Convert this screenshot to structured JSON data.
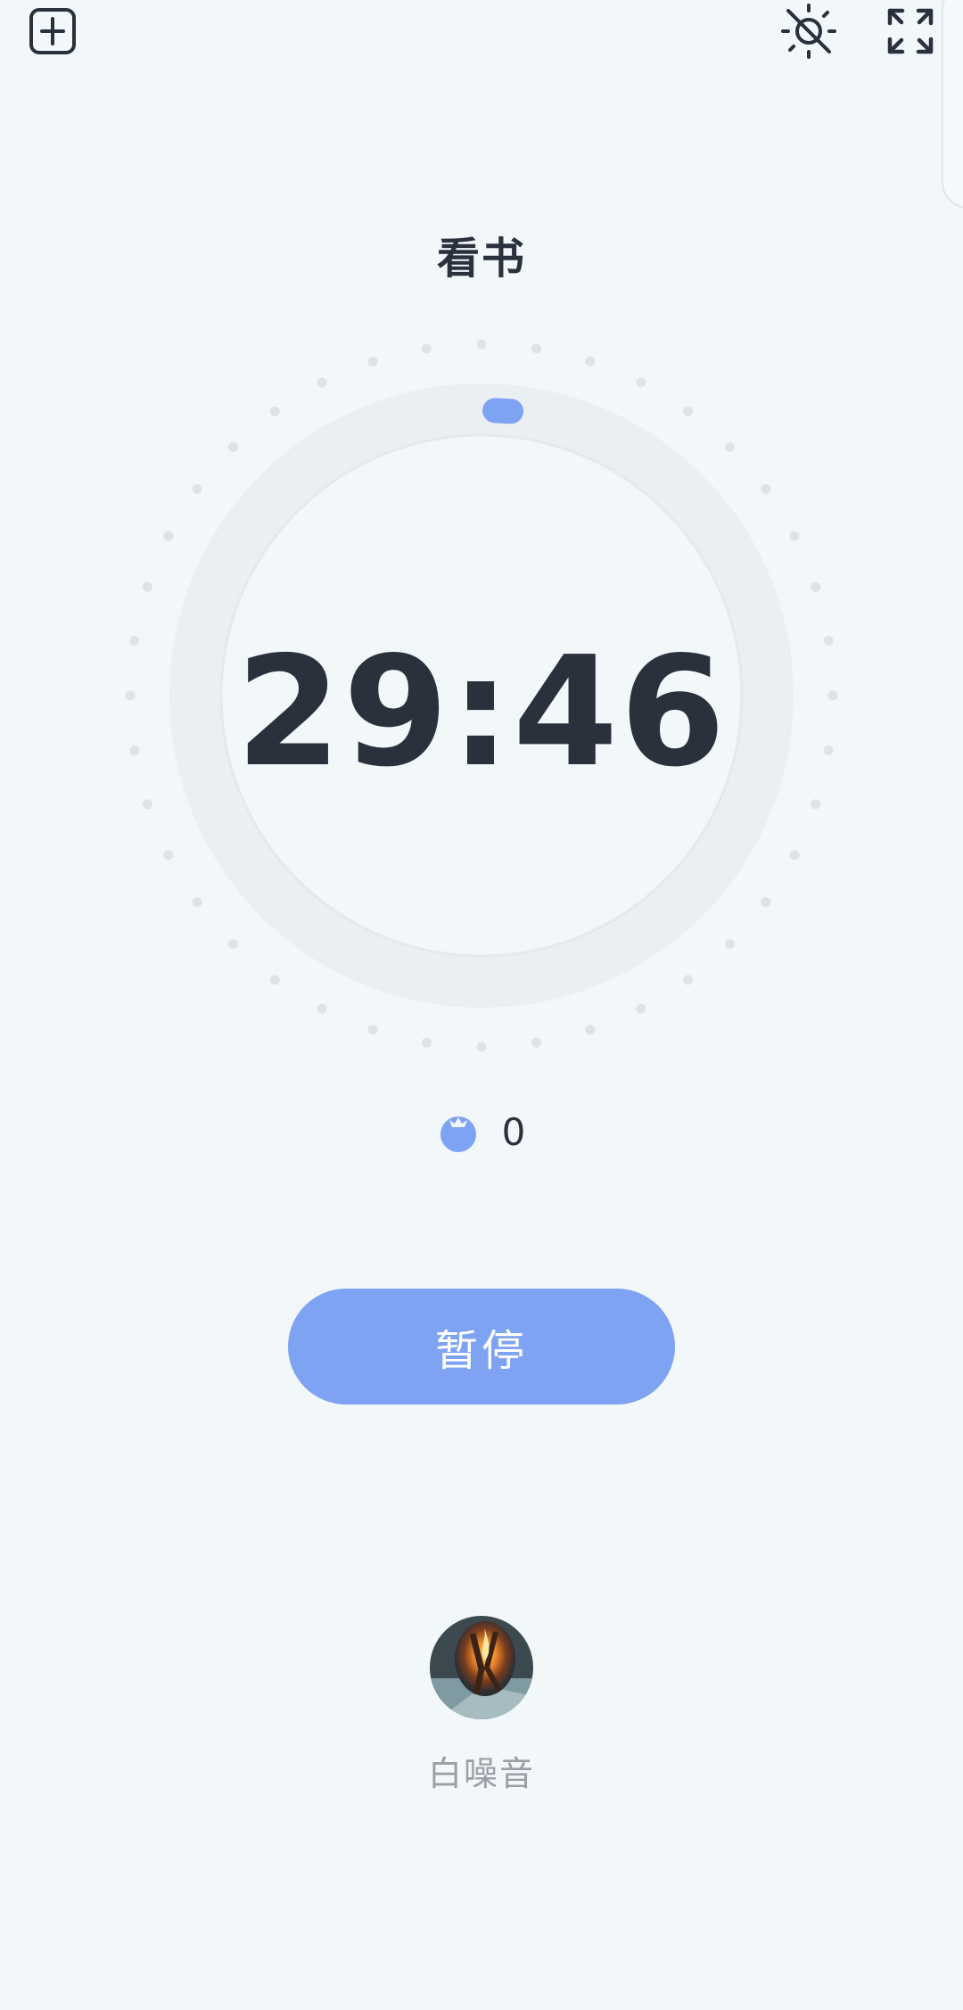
{
  "header": {
    "minimize_icon": "minimize-window-icon",
    "screen_awake_icon": "screen-awake-off-icon",
    "fullscreen_icon": "fullscreen-icon"
  },
  "task": {
    "title": "看书"
  },
  "timer": {
    "display": "29:46",
    "progress": 0.008
  },
  "pomodoro": {
    "icon": "tomato-icon",
    "count": "0"
  },
  "controls": {
    "pause_label": "暂停"
  },
  "white_noise": {
    "label": "白噪音",
    "icon": "campfire-image"
  },
  "colors": {
    "accent": "#7fa3f3",
    "background": "#f2f7fa",
    "text_dark": "#2b303d",
    "text_muted": "#9a9ea5"
  }
}
